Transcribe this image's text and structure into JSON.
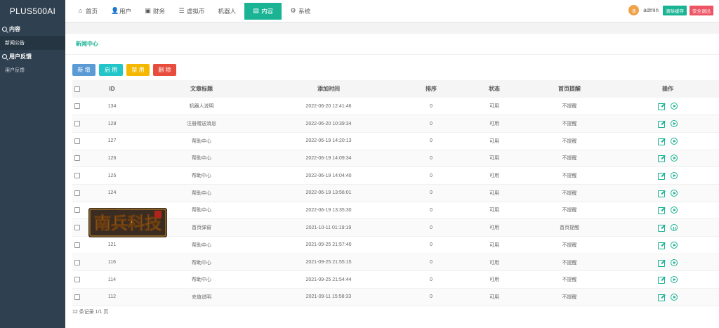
{
  "app": {
    "title": "PLUS500AI"
  },
  "sidebar": {
    "groups": [
      {
        "label": "内容",
        "items": [
          {
            "label": "新闻公告"
          }
        ]
      },
      {
        "label": "用户反馈",
        "items": [
          {
            "label": "用户反馈"
          }
        ]
      }
    ]
  },
  "topnav": {
    "items": [
      {
        "label": "首页",
        "icon": "home-icon"
      },
      {
        "label": "用户",
        "icon": "user-icon"
      },
      {
        "label": "财务",
        "icon": "wallet-icon"
      },
      {
        "label": "虚拟币",
        "icon": "database-icon"
      },
      {
        "label": "机器人",
        "icon": ""
      },
      {
        "label": "内容",
        "icon": "document-icon"
      },
      {
        "label": "系统",
        "icon": "gear-icon"
      }
    ],
    "active": "内容"
  },
  "user": {
    "avatar_letter": "a",
    "name": "admin",
    "clear_cache": "清除缓存",
    "logout": "安全退出"
  },
  "page": {
    "title": "新闻中心",
    "buttons": {
      "add": "新 增",
      "enable": "启 用",
      "disable": "禁 用",
      "delete": "删 除"
    },
    "footer": "12 条记录 1/1 页"
  },
  "table": {
    "headers": [
      "",
      "ID",
      "文章标题",
      "添加时间",
      "排序",
      "状态",
      "首页提醒",
      "操作"
    ],
    "rows": [
      {
        "id": "134",
        "title": "机器人说明",
        "time": "2022-06-20 12:41:46",
        "sort": "0",
        "status": "可用",
        "remind": "不提醒",
        "toggle": "play"
      },
      {
        "id": "128",
        "title": "注册赠送消息",
        "time": "2022-06-20 10:39:34",
        "sort": "0",
        "status": "可用",
        "remind": "不提醒",
        "toggle": "play"
      },
      {
        "id": "127",
        "title": "帮助中心",
        "time": "2022-06-19 14:20:13",
        "sort": "0",
        "status": "可用",
        "remind": "不提醒",
        "toggle": "play"
      },
      {
        "id": "126",
        "title": "帮助中心",
        "time": "2022-06-19 14:09:34",
        "sort": "0",
        "status": "可用",
        "remind": "不提醒",
        "toggle": "play"
      },
      {
        "id": "125",
        "title": "帮助中心",
        "time": "2022-06-19 14:04:40",
        "sort": "0",
        "status": "可用",
        "remind": "不提醒",
        "toggle": "play"
      },
      {
        "id": "124",
        "title": "帮助中心",
        "time": "2022-06-19 13:56:01",
        "sort": "0",
        "status": "可用",
        "remind": "不提醒",
        "toggle": "play"
      },
      {
        "id": "123",
        "title": "帮助中心",
        "time": "2022-06-19 13:35:30",
        "sort": "0",
        "status": "可用",
        "remind": "不提醒",
        "toggle": "play"
      },
      {
        "id": "122",
        "title": "首页弹窗",
        "time": "2021-10-11 01:19:19",
        "sort": "0",
        "status": "可用",
        "remind": "首页提醒",
        "toggle": "pause"
      },
      {
        "id": "121",
        "title": "帮助中心",
        "time": "2021-09-25 21:57:40",
        "sort": "0",
        "status": "可用",
        "remind": "不提醒",
        "toggle": "play"
      },
      {
        "id": "116",
        "title": "帮助中心",
        "time": "2021-09-25 21:55:15",
        "sort": "0",
        "status": "可用",
        "remind": "不提醒",
        "toggle": "play"
      },
      {
        "id": "114",
        "title": "帮助中心",
        "time": "2021-09-25 21:54:44",
        "sort": "0",
        "status": "可用",
        "remind": "不提醒",
        "toggle": "play"
      },
      {
        "id": "112",
        "title": "充值说明",
        "time": "2021-09-11 15:58:33",
        "sort": "0",
        "status": "可用",
        "remind": "不提醒",
        "toggle": "play"
      }
    ]
  },
  "watermark": {
    "text": "南兵科技"
  },
  "colors": {
    "accent": "#1ab394",
    "sidebar": "#2f4050",
    "danger": "#e74c3c"
  }
}
